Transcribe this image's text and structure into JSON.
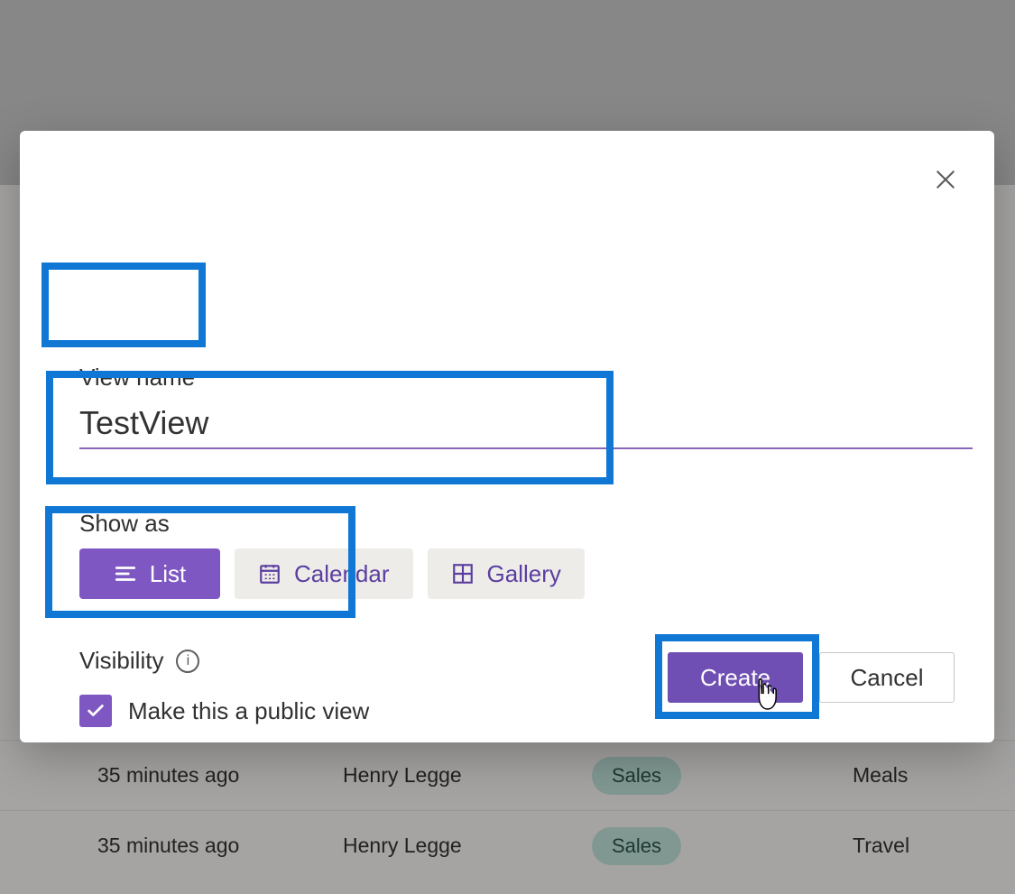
{
  "dialog": {
    "view_name_label": "View name",
    "view_name_value": "TestView",
    "show_as_label": "Show as",
    "options": {
      "list": "List",
      "calendar": "Calendar",
      "gallery": "Gallery"
    },
    "visibility_label": "Visibility",
    "visibility_checkbox_label": "Make this a public view",
    "visibility_checked": true,
    "buttons": {
      "create": "Create",
      "cancel": "Cancel"
    }
  },
  "background_rows": [
    {
      "time": "35 minutes ago",
      "person": "Henry Legge",
      "tag": "Sales",
      "category": "Meals"
    },
    {
      "time": "35 minutes ago",
      "person": "Henry Legge",
      "tag": "Sales",
      "category": "Travel"
    }
  ],
  "colors": {
    "accent": "#7e57c2",
    "highlight_outline": "#1078d4"
  }
}
